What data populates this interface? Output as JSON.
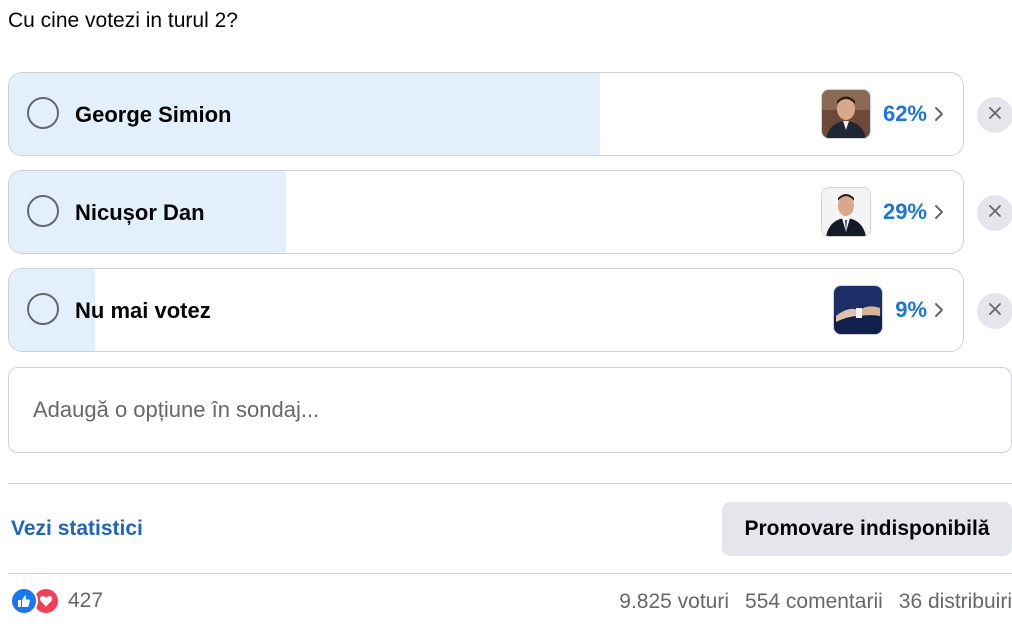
{
  "question": "Cu cine votezi in turul 2?",
  "options": [
    {
      "label": "George Simion",
      "percent_label": "62%",
      "percent": 62
    },
    {
      "label": "Nicușor Dan",
      "percent_label": "29%",
      "percent": 29
    },
    {
      "label": "Nu mai votez",
      "percent_label": "9%",
      "percent": 9
    }
  ],
  "add_option": {
    "placeholder": "Adaugă o opțiune în sondaj..."
  },
  "stats_link": "Vezi statistici",
  "promo_button": "Promovare indisponibilă",
  "reactions": {
    "count": "427",
    "icons": [
      "like-icon",
      "love-icon"
    ]
  },
  "footer": {
    "votes": "9.825 voturi",
    "comments": "554 comentarii",
    "shares": "36 distribuiri"
  },
  "colors": {
    "accent": "#1b74e4",
    "bar_fill": "#e3f0fc",
    "link": "#1d65c1",
    "button_bg": "#e4e6eb"
  }
}
